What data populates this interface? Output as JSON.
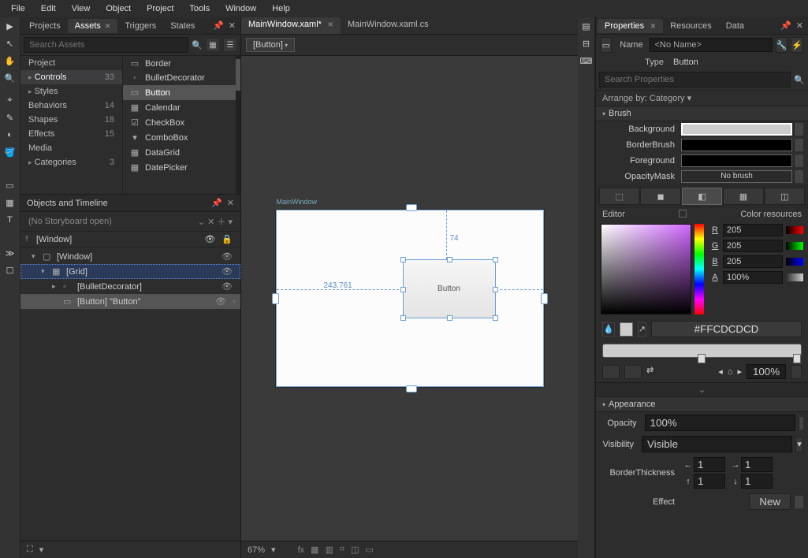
{
  "menu": [
    "File",
    "Edit",
    "View",
    "Object",
    "Project",
    "Tools",
    "Window",
    "Help"
  ],
  "leftTabs": {
    "items": [
      "Projects",
      "Assets",
      "Triggers",
      "States"
    ],
    "activeIndex": 1
  },
  "assets": {
    "searchPlaceholder": "Search Assets",
    "categories": [
      {
        "label": "Project",
        "exp": "",
        "count": ""
      },
      {
        "label": "Controls",
        "exp": "▸",
        "count": "33",
        "sel": true
      },
      {
        "label": "Styles",
        "exp": "▸",
        "count": ""
      },
      {
        "label": "Behaviors",
        "exp": "",
        "count": "14"
      },
      {
        "label": "Shapes",
        "exp": "",
        "count": "18"
      },
      {
        "label": "Effects",
        "exp": "",
        "count": "15"
      },
      {
        "label": "Media",
        "exp": "",
        "count": ""
      },
      {
        "label": "Categories",
        "exp": "▸",
        "count": "3"
      }
    ],
    "controls": [
      {
        "icon": "▭",
        "label": "Border"
      },
      {
        "icon": "◦",
        "label": "BulletDecorator"
      },
      {
        "icon": "▭",
        "label": "Button",
        "sel": true
      },
      {
        "icon": "▦",
        "label": "Calendar"
      },
      {
        "icon": "☑",
        "label": "CheckBox"
      },
      {
        "icon": "▾",
        "label": "ComboBox"
      },
      {
        "icon": "▦",
        "label": "DataGrid"
      },
      {
        "icon": "▦",
        "label": "DatePicker"
      }
    ]
  },
  "timeline": {
    "title": "Objects and Timeline",
    "storyboard": "(No Storyboard open)",
    "root": "[Window]",
    "tree": [
      {
        "indent": 0,
        "exp": "▾",
        "icon": "▢",
        "label": "[Window]",
        "eye": true
      },
      {
        "indent": 1,
        "exp": "▾",
        "icon": "▦",
        "label": "[Grid]",
        "eye": true,
        "sel": true
      },
      {
        "indent": 2,
        "exp": "▸",
        "icon": "◦",
        "label": "[BulletDecorator]",
        "eye": true
      },
      {
        "indent": 2,
        "exp": "",
        "icon": "▭",
        "label": "[Button] \"Button\"",
        "eye": true,
        "lock": true,
        "sel2": true
      }
    ]
  },
  "docs": {
    "tabs": [
      "MainWindow.xaml*",
      "MainWindow.xaml.cs"
    ],
    "activeIndex": 0,
    "breadcrumb": "[Button]"
  },
  "design": {
    "windowTitle": "MainWindow",
    "buttonText": "Button",
    "measureX": "243.761",
    "measureY": "74"
  },
  "status": {
    "zoom": "67%"
  },
  "rightTabs": {
    "items": [
      "Properties",
      "Resources",
      "Data"
    ],
    "activeIndex": 0
  },
  "properties": {
    "nameLabel": "Name",
    "nameValue": "<No Name>",
    "typeLabel": "Type",
    "typeValue": "Button",
    "searchPlaceholder": "Search Properties",
    "arrangeBy": "Arrange by: Category ▾",
    "brush": {
      "title": "Brush",
      "rows": [
        {
          "label": "Background",
          "bg": "#cdcdcd",
          "sel": true
        },
        {
          "label": "BorderBrush",
          "bg": "#000"
        },
        {
          "label": "Foreground",
          "bg": "#000"
        },
        {
          "label": "OpacityMask",
          "text": "No brush"
        }
      ],
      "editorLabel": "Editor",
      "resLabel": "Color resources",
      "rgba": [
        {
          "l": "R",
          "v": "205"
        },
        {
          "l": "G",
          "v": "205"
        },
        {
          "l": "B",
          "v": "205"
        },
        {
          "l": "A",
          "v": "100%"
        }
      ],
      "hex": "#FFCDCDCD",
      "gradPct": "100%"
    },
    "appearance": {
      "title": "Appearance",
      "opacityLabel": "Opacity",
      "opacity": "100%",
      "visibilityLabel": "Visibility",
      "visibility": "Visible",
      "borderThkLabel": "BorderThickness",
      "thk": [
        "1",
        "1",
        "1",
        "1"
      ],
      "effectLabel": "Effect",
      "effectBtn": "New"
    }
  }
}
